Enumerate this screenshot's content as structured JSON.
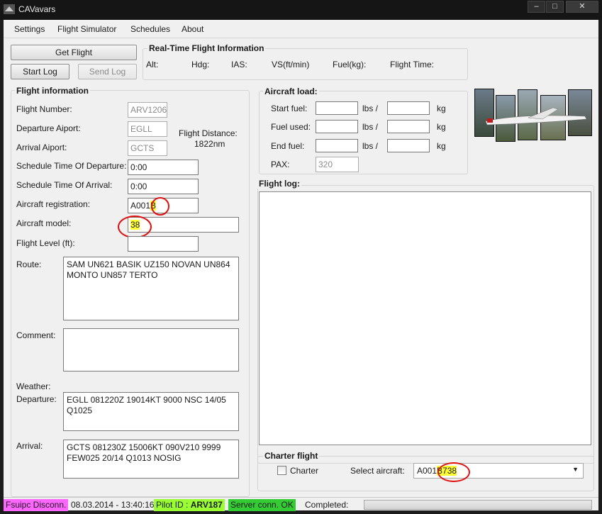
{
  "window": {
    "title": "CAVavars",
    "minimize": "–",
    "maximize": "□",
    "close": "✕"
  },
  "menu": [
    "Settings",
    "Flight Simulator",
    "Schedules",
    "About"
  ],
  "buttons": {
    "get_flight": "Get Flight",
    "start_log": "Start Log",
    "send_log": "Send Log"
  },
  "realtime": {
    "title": "Real-Time Flight Information",
    "labels": [
      "Alt:",
      "Hdg:",
      "IAS:",
      "VS(ft/min)",
      "Fuel(kg):",
      "Flight Time:"
    ]
  },
  "flight_info": {
    "title": "Flight information",
    "flight_number_label": "Flight Number:",
    "flight_number": "ARV1206",
    "departure_label": "Departure Aiport:",
    "departure": "EGLL",
    "arrival_label": "Arrival Aiport:",
    "arrival": "GCTS",
    "distance_label": "Flight Distance:",
    "distance": "1822nm",
    "std_label": "Schedule Time Of Departure:",
    "std": "0:00",
    "sta_label": "Schedule Time Of Arrival:",
    "sta": "0:00",
    "registration_label": "Aircraft registration:",
    "registration_prefix": "A001",
    "registration_highlight": "B",
    "model_label": "Aircraft model:",
    "model": "38",
    "flight_level_label": "Flight Level (ft):",
    "flight_level": "",
    "route_label": "Route:",
    "route": "SAM UN621 BASIK UZ150 NOVAN UN864 MONTO UN857 TERTO",
    "comment_label": "Comment:",
    "comment": "",
    "weather_label": "Weather:",
    "weather_departure_label": "Departure:",
    "weather_departure": "EGLL 081220Z 19014KT 9000 NSC 14/05 Q1025",
    "weather_arrival_label": "Arrival:",
    "weather_arrival": "GCTS 081230Z 15006KT 090V210 9999 FEW025 20/14 Q1013 NOSIG"
  },
  "aircraft_load": {
    "title": "Aircraft load:",
    "start_fuel_label": "Start fuel:",
    "used_fuel_label": "Fuel used:",
    "end_fuel_label": "End fuel:",
    "lbs_unit": "lbs /",
    "kg_unit": "kg",
    "pax_label": "PAX:",
    "pax": "320"
  },
  "flight_log": {
    "title": "Flight log:"
  },
  "charter": {
    "title": "Charter flight",
    "checkbox_label": "Charter",
    "select_label": "Select aircraft:",
    "aircraft_prefix": "A001",
    "aircraft_highlight": "B738"
  },
  "status": {
    "fsuipc": "Fsuipc Disconn.",
    "datetime": "08.03.2014 - 13:40:16",
    "pilot_label": "Pilot ID :",
    "pilot_id": "ARV187",
    "server": "Server conn. OK",
    "completed": "Completed:",
    "progress": 0
  },
  "colors": {
    "fsuipc_bg": "#ff66ff",
    "pilot_bg": "#99ff33",
    "server_bg": "#33cc33",
    "highlight": "#ffff33",
    "circle": "#e01010"
  }
}
